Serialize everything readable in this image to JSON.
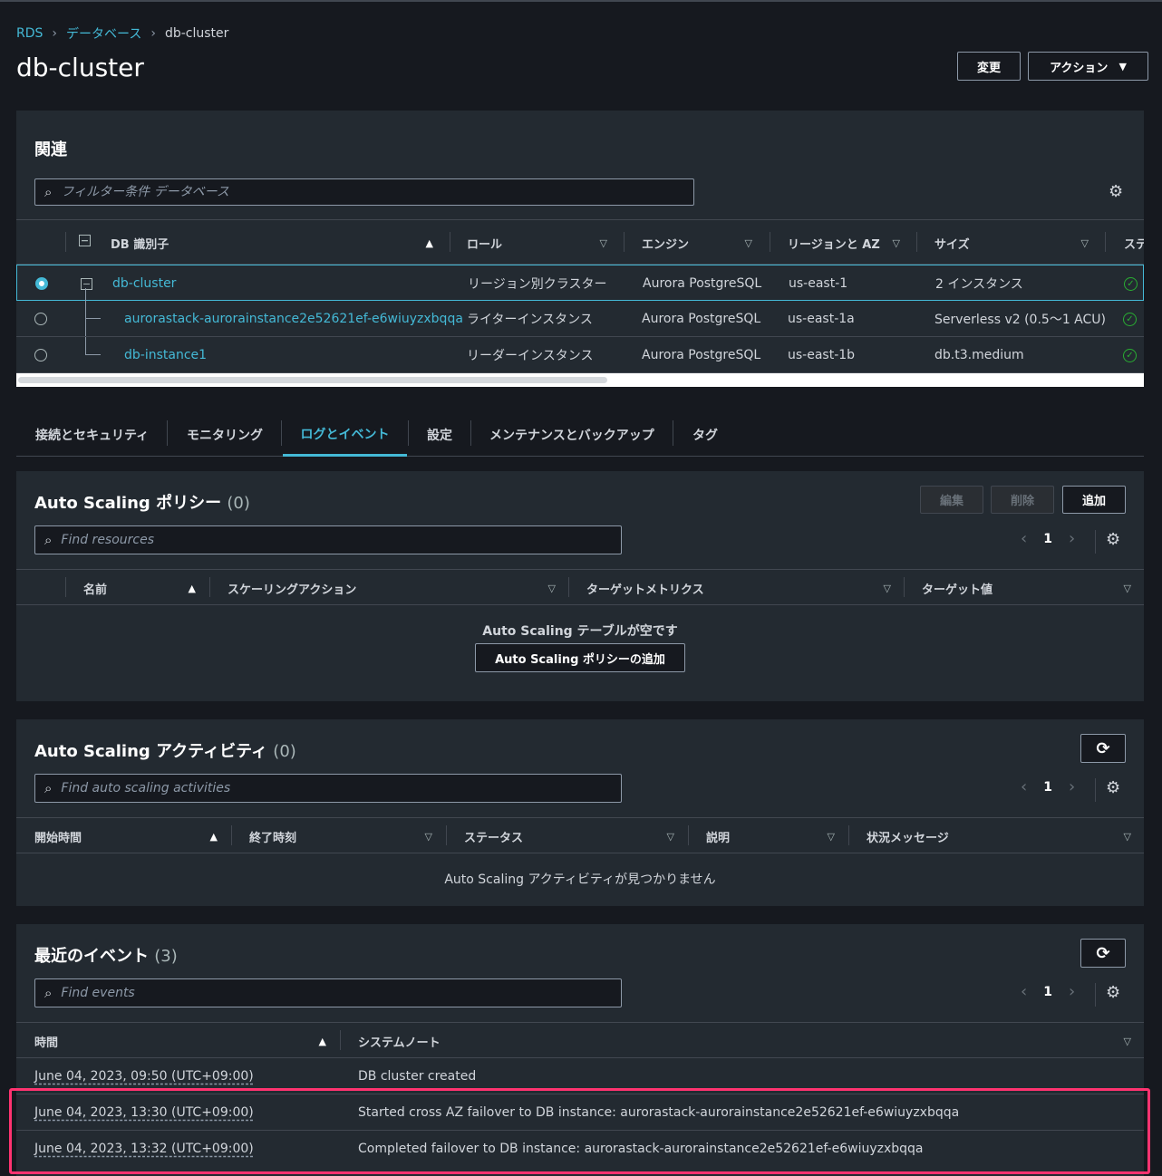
{
  "breadcrumb": {
    "items": [
      "RDS",
      "データベース"
    ],
    "current": "db-cluster"
  },
  "page": {
    "title": "db-cluster"
  },
  "header_actions": {
    "modify": "変更",
    "actions": "アクション"
  },
  "related": {
    "title": "関連",
    "filter_placeholder": "フィルター条件 データベース",
    "columns": [
      "DB 識別子",
      "ロール",
      "エンジン",
      "リージョンと AZ",
      "サイズ",
      "ステ"
    ],
    "rows": [
      {
        "id": "db-cluster",
        "role": "リージョン別クラスター",
        "engine": "Aurora PostgreSQL",
        "region": "us-east-1",
        "size": "2 インスタンス",
        "selected": true
      },
      {
        "id": "aurorastack-aurorainstance2e52621ef-e6wiuyzxbqqa",
        "role": "ライターインスタンス",
        "engine": "Aurora PostgreSQL",
        "region": "us-east-1a",
        "size": "Serverless v2 (0.5〜1 ACU)",
        "selected": false
      },
      {
        "id": "db-instance1",
        "role": "リーダーインスタンス",
        "engine": "Aurora PostgreSQL",
        "region": "us-east-1b",
        "size": "db.t3.medium",
        "selected": false
      }
    ]
  },
  "tabs": [
    "接続とセキュリティ",
    "モニタリング",
    "ログとイベント",
    "設定",
    "メンテナンスとバックアップ",
    "タグ"
  ],
  "active_tab": "ログとイベント",
  "policies": {
    "title": "Auto Scaling ポリシー",
    "count": "(0)",
    "buttons": {
      "edit": "編集",
      "delete": "削除",
      "add": "追加"
    },
    "search_placeholder": "Find resources",
    "page": "1",
    "columns": [
      "名前",
      "スケーリングアクション",
      "ターゲットメトリクス",
      "ターゲット値"
    ],
    "empty_text": "Auto Scaling テーブルが空です",
    "empty_button": "Auto Scaling ポリシーの追加"
  },
  "activities": {
    "title": "Auto Scaling アクティビティ",
    "count": "(0)",
    "search_placeholder": "Find auto scaling activities",
    "page": "1",
    "columns": [
      "開始時間",
      "終了時刻",
      "ステータス",
      "説明",
      "状況メッセージ"
    ],
    "empty_text": "Auto Scaling アクティビティが見つかりません"
  },
  "events": {
    "title": "最近のイベント",
    "count": "(3)",
    "search_placeholder": "Find events",
    "page": "1",
    "columns": [
      "時間",
      "システムノート"
    ],
    "rows": [
      {
        "time": "June 04, 2023, 09:50 (UTC+09:00)",
        "note": "DB cluster created"
      },
      {
        "time": "June 04, 2023, 13:30 (UTC+09:00)",
        "note": "Started cross AZ failover to DB instance: aurorastack-aurorainstance2e52621ef-e6wiuyzxbqqa"
      },
      {
        "time": "June 04, 2023, 13:32 (UTC+09:00)",
        "note": "Completed failover to DB instance: aurorastack-aurorainstance2e52621ef-e6wiuyzxbqqa"
      }
    ]
  },
  "colors": {
    "accent": "#44b9d6",
    "highlight": "#ff3370",
    "success": "#29ad32",
    "panel": "#232a31",
    "background": "#16191f"
  },
  "icons": [
    "chevron-right-icon",
    "caret-down-icon",
    "search-icon",
    "gear-icon",
    "refresh-icon",
    "sort-asc-icon",
    "sort-desc-icon",
    "status-available-icon",
    "collapse-icon"
  ]
}
